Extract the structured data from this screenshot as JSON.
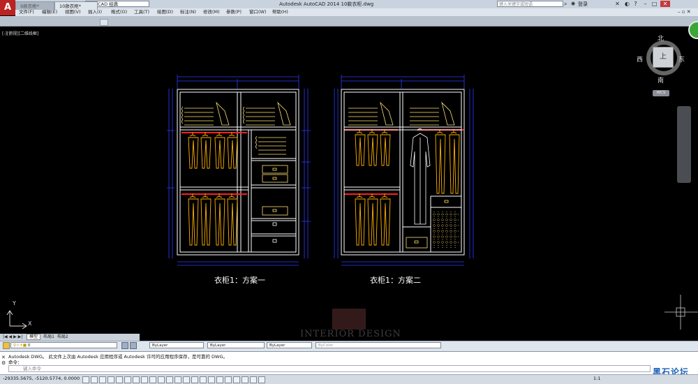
{
  "app": {
    "logo_letter": "A",
    "workspace": "AutoCAD 经典",
    "title": "Autodesk AutoCAD 2014    10款衣柜.dwg",
    "search_placeholder": "键入关键字或短语",
    "login": "登录"
  },
  "menu": [
    "文件(F)",
    "编辑(E)",
    "视图(V)",
    "插入(I)",
    "格式(O)",
    "工具(T)",
    "绘图(D)",
    "标注(N)",
    "修改(M)",
    "参数(P)",
    "窗口(W)",
    "帮助(H)"
  ],
  "tabs": [
    {
      "label": "9款衣柜*",
      "active": false
    },
    {
      "label": "10款衣柜*",
      "active": true
    }
  ],
  "viewport_label": "[-][俯视][二维线框]",
  "navcube": {
    "north": "北",
    "south": "南",
    "east": "东",
    "west": "西",
    "top": "上",
    "wcs": "WCS"
  },
  "drawing": {
    "caption_left": "衣柜1：方案一",
    "caption_right": "衣柜1：方案二"
  },
  "ucs": {
    "x": "X",
    "y": "Y"
  },
  "layout_tabs": [
    "模型",
    "布局1",
    "布局2"
  ],
  "properties": {
    "layer": "0",
    "color": "ByLayer",
    "linetype": "ByLayer",
    "lineweight": "ByLayer",
    "plotstyle": "ByColor"
  },
  "command": {
    "line1": "Autodesk DWG。  此文件上次由 Autodesk 应用程序或 Autodesk 许可的应用程序保存，是可靠的 DWG。",
    "line2": "命令：",
    "input_placeholder": "键入命令"
  },
  "status": {
    "coords": "-29335.5675, -5120.5774, 0.0000",
    "scale": "1:1"
  },
  "watermark": {
    "cn": "黑石论坛",
    "en": "INTERIOR DESIGN"
  },
  "colors": {
    "cad_bg": "#000000",
    "cabinet": "#ffffff",
    "dimension": "#2b3cff",
    "garment": "#ffb000",
    "rail": "#ff2020",
    "drawer": "#ffe070"
  }
}
